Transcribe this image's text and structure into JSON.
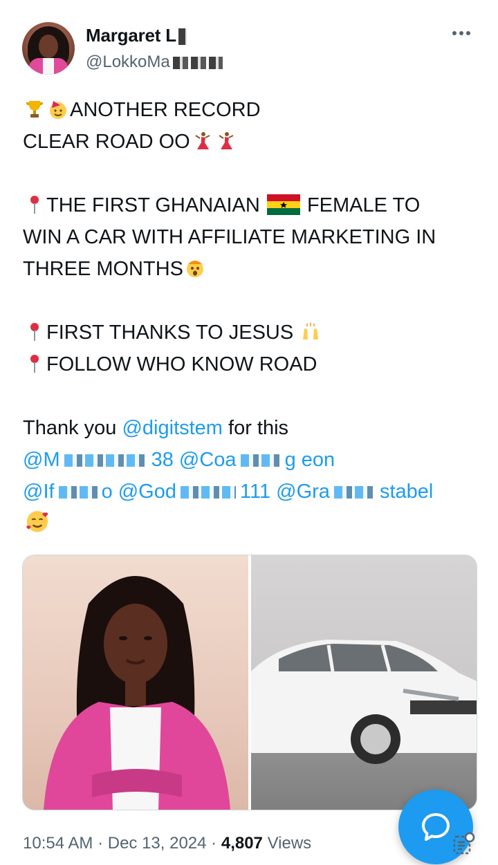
{
  "author": {
    "display_name": "Margaret L",
    "handle": "@LokkoMa",
    "avatar_icon": "profile-photo"
  },
  "tweet": {
    "line1": "ANOTHER RECORD",
    "line2": "CLEAR ROAD OO",
    "line3a": "THE FIRST GHANAIAN",
    "line3b": "FEMALE TO",
    "line4": "WIN A CAR WITH AFFILIATE MARKETING IN",
    "line5": "THREE MONTHS",
    "line6": "FIRST THANKS TO JESUS",
    "line7": "FOLLOW WHO KNOW ROAD",
    "thanks_prefix": "Thank you",
    "thanks_mention": "@digitstem",
    "thanks_suffix": "for this",
    "mentions_row1": [
      "@M",
      "38 @Coa",
      "g eon"
    ],
    "mentions_row2": [
      "@If",
      "o @God",
      "111 @Gra",
      "stabel"
    ]
  },
  "media": {
    "left_image": "portrait-woman-pink-blazer",
    "right_image": "white-sedan-car"
  },
  "meta": {
    "time": "10:54 AM",
    "date": "Dec 13, 2024",
    "views_count": "4,807",
    "views_label": "Views"
  },
  "icons": {
    "more": "more-dots-icon",
    "reply_fab": "reply-bubble-icon",
    "analytics": "analytics-icon"
  },
  "colors": {
    "accent": "#1d9bf0",
    "text": "#0f1419",
    "secondary": "#536471"
  }
}
